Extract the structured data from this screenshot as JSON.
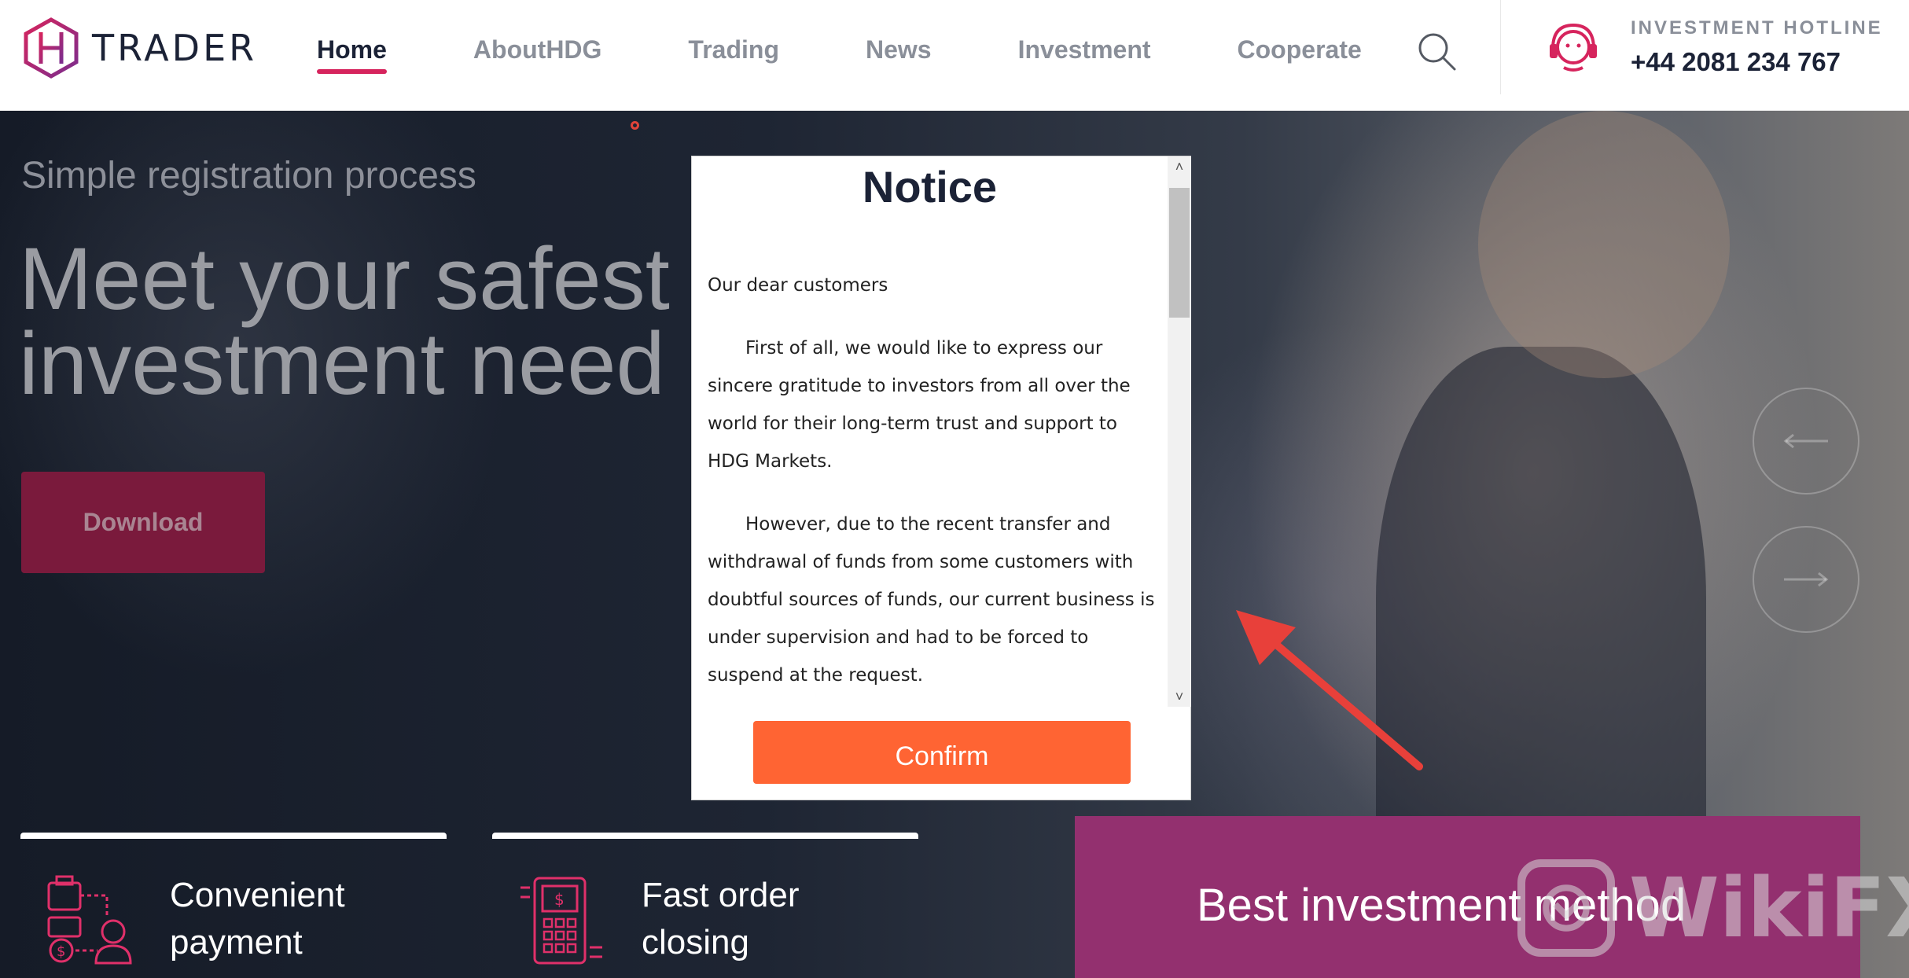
{
  "header": {
    "logo_text": "TRADER",
    "nav": [
      {
        "label": "Home",
        "active": true
      },
      {
        "label": "AboutHDG",
        "active": false
      },
      {
        "label": "Trading",
        "active": false
      },
      {
        "label": "News",
        "active": false
      },
      {
        "label": "Investment",
        "active": false
      },
      {
        "label": "Cooperate",
        "active": false
      }
    ],
    "search_icon": "search-icon",
    "hotline": {
      "icon": "headset-icon",
      "label": "INVESTMENT HOTLINE",
      "number": "+44 2081 234 767"
    }
  },
  "hero": {
    "subtitle": "Simple registration process",
    "title_line1": "Meet your safest",
    "title_line2": "investment need",
    "download_label": "Download",
    "prev_icon": "arrow-left-icon",
    "next_icon": "arrow-right-icon"
  },
  "features": [
    {
      "icon": "wallet-payment-icon",
      "line1": "Convenient",
      "line2": "payment"
    },
    {
      "icon": "pos-terminal-icon",
      "line1": "Fast order",
      "line2": "closing"
    }
  ],
  "best_method": "Best investment method",
  "watermark": "WikiFX",
  "notice": {
    "title": "Notice",
    "greeting": "Our dear customers",
    "paragraph1": "First of all, we would like to express our sincere gratitude to investors from all over the world for their long-term trust and support to HDG Markets.",
    "paragraph2": "However, due to the recent transfer and withdrawal of funds from some customers with doubtful sources of funds, our current business is under supervision and had to be forced to suspend at the request.",
    "confirm_label": "Confirm",
    "scroll_up": "˄",
    "scroll_down": "˅"
  },
  "colors": {
    "accent_pink": "#d6245d",
    "confirm_orange": "#ff6433",
    "best_box_purple": "#93306f",
    "download_button": "#7a1a3c",
    "arrow_red": "#e8403a"
  }
}
